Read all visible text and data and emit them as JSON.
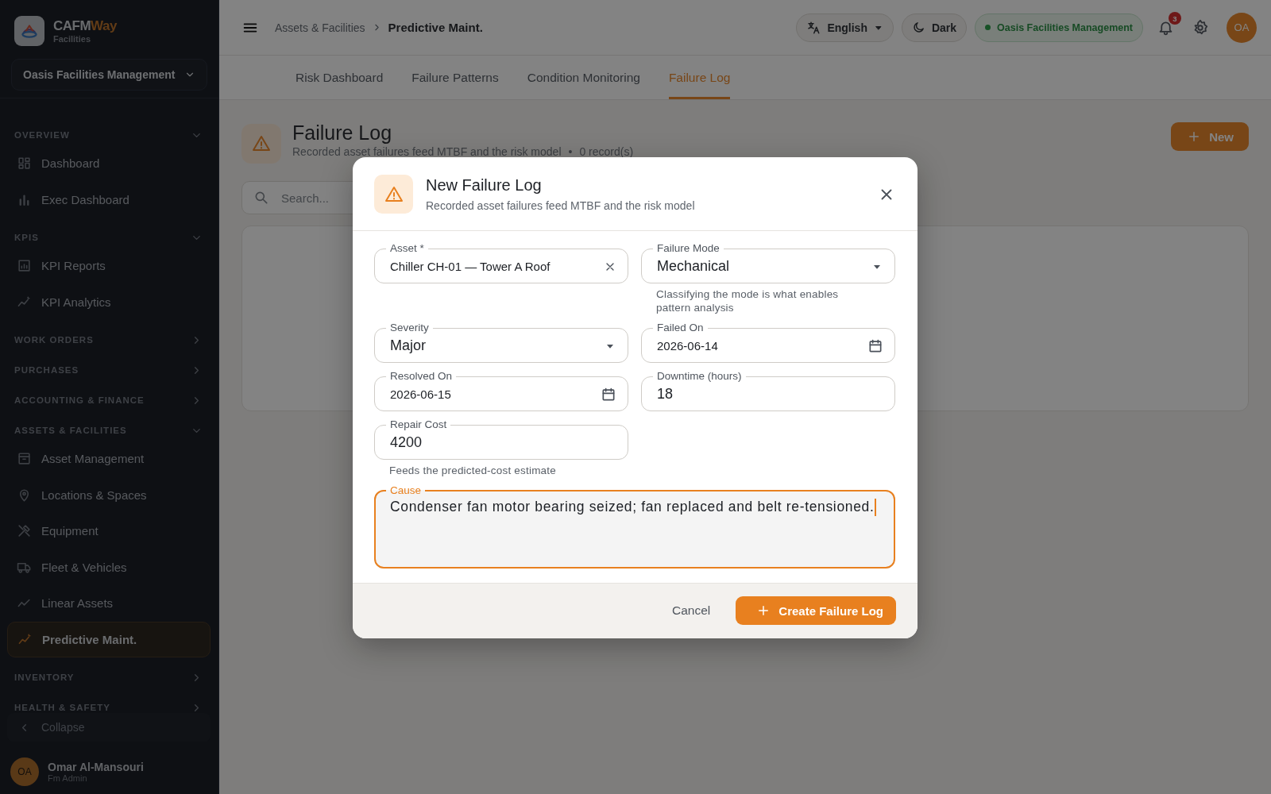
{
  "brand": {
    "name": "CAFM",
    "name_accent": "Way",
    "subtitle": "Facilities"
  },
  "org_selector": {
    "value": "Oasis Facilities Management"
  },
  "nav": [
    {
      "label": "OVERVIEW",
      "expanded": true,
      "children": [
        {
          "label": "Dashboard",
          "selected": false
        },
        {
          "label": "Exec Dashboard",
          "selected": false
        }
      ]
    },
    {
      "label": "KPIS",
      "expanded": true,
      "children": [
        {
          "label": "KPI Reports",
          "selected": false
        },
        {
          "label": "KPI Analytics",
          "selected": false
        }
      ]
    },
    {
      "label": "WORK ORDERS",
      "expanded": false
    },
    {
      "label": "PURCHASES",
      "expanded": false
    },
    {
      "label": "ACCOUNTING & FINANCE",
      "expanded": false
    },
    {
      "label": "ASSETS & FACILITIES",
      "expanded": true,
      "children": [
        {
          "label": "Asset Management",
          "selected": false
        },
        {
          "label": "Locations & Spaces",
          "selected": false
        },
        {
          "label": "Equipment",
          "selected": false
        },
        {
          "label": "Fleet & Vehicles",
          "selected": false
        },
        {
          "label": "Linear Assets",
          "selected": false
        },
        {
          "label": "Predictive Maint.",
          "selected": true
        }
      ]
    },
    {
      "label": "INVENTORY",
      "expanded": false
    },
    {
      "label": "HEALTH & SAFETY",
      "expanded": false
    }
  ],
  "collapse": "Collapse",
  "user": {
    "initials": "OA",
    "name": "Omar Al-Mansouri",
    "role": "Fm Admin"
  },
  "topbar": {
    "breadcrumb": [
      "Assets & Facilities",
      "Predictive Maint."
    ],
    "language": "English",
    "theme": "Dark",
    "org_badge": "Oasis Facilities Management",
    "notifications": "3",
    "avatar": "OA"
  },
  "tabs": [
    {
      "label": "Risk Dashboard",
      "selected": false
    },
    {
      "label": "Failure Patterns",
      "selected": false
    },
    {
      "label": "Condition Monitoring",
      "selected": false
    },
    {
      "label": "Failure Log",
      "selected": true
    }
  ],
  "page": {
    "title": "Failure Log",
    "subtitle": "Recorded asset failures feed MTBF and the risk model",
    "separator": "•",
    "record_count": "0 record(s)",
    "new_button": "New",
    "search": {
      "placeholder": "Search..."
    }
  },
  "modal": {
    "title": "New Failure Log",
    "subtitle": "Recorded asset failures feed MTBF and the risk model",
    "fields": [
      {
        "kind": "autocomplete",
        "label": "Asset *",
        "value": "Chiller CH-01 — Tower A Roof",
        "focused": false
      },
      {
        "kind": "select",
        "label": "Failure Mode",
        "value": "Mechanical",
        "helper": "Classifying the mode is what enables pattern analysis",
        "focused": false
      },
      {
        "kind": "select",
        "label": "Severity",
        "value": "Major",
        "focused": false
      },
      {
        "kind": "date",
        "label": "Failed On",
        "value": "2026-06-14",
        "focused": false
      },
      {
        "kind": "date",
        "label": "Resolved On",
        "value": "2026-06-15",
        "focused": false
      },
      {
        "kind": "number",
        "label": "Downtime (hours)",
        "value": "18",
        "focused": false
      },
      {
        "kind": "number",
        "label": "Repair Cost",
        "value": "4200",
        "helper": "Feeds the predicted-cost estimate",
        "focused": false
      },
      {
        "kind": "textarea",
        "label": "Cause",
        "value": "Condenser fan motor bearing seized; fan replaced and belt re-tensioned.",
        "focused": true
      }
    ],
    "cancel": "Cancel",
    "submit": "Create Failure Log"
  }
}
